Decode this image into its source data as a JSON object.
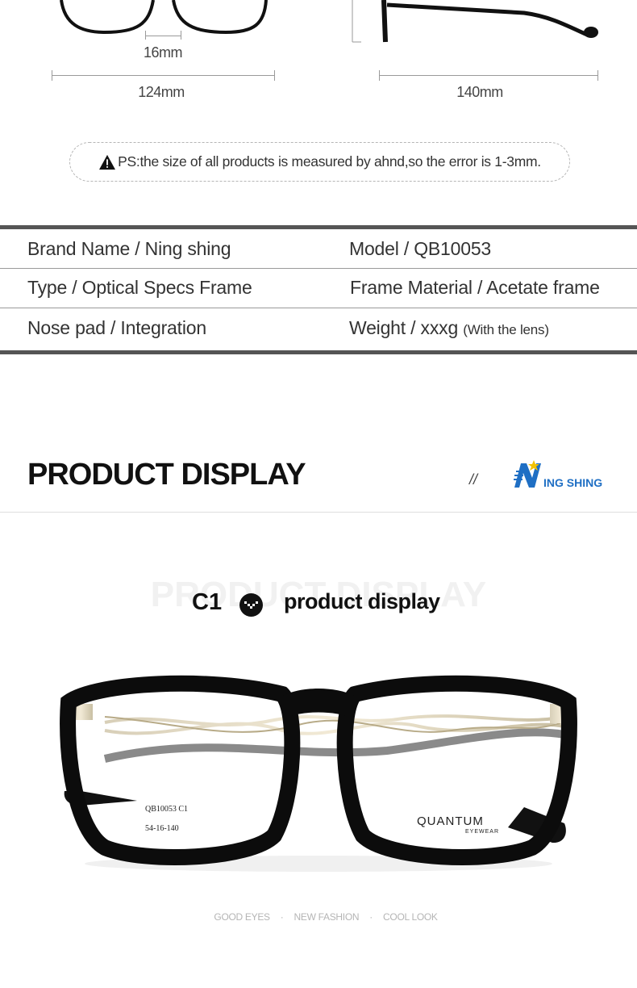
{
  "dimensions": {
    "bridge": "16mm",
    "frame_width": "124mm",
    "temple_length": "140mm"
  },
  "note": {
    "text": "PS:the size of all products is measured by ahnd,so the error is 1-3mm."
  },
  "specs": {
    "brand_label": "Brand Name  /   Ning shing",
    "model_label": "Model /  QB10053",
    "type_label": "Type  /  Optical Specs Frame",
    "material_label": "Frame Material  /  Acetate frame",
    "nosepad_label": "Nose pad  / Integration",
    "weight_label": "Weight  /   xxxg",
    "weight_note": "(With the lens)"
  },
  "section": {
    "title": "PRODUCT DISPLAY",
    "slash": "//",
    "logo_text": "ING SHING"
  },
  "color_section": {
    "ghost": "PRODUCT DISPLAY",
    "code": "C1",
    "label": "product display"
  },
  "product": {
    "lens_text_1": "QB10053  C1",
    "lens_text_2": "54-16-140",
    "brand_top": "QUANTUM",
    "brand_bottom": "EYEWEAR"
  },
  "tagline": {
    "item1": "GOOD EYES",
    "sep1": "·",
    "item2": "NEW FASHION",
    "sep2": "·",
    "item3": "COOL LOOK"
  },
  "colors": {
    "accent_blue": "#1f6fc4",
    "accent_yellow": "#f2c200",
    "table_bar": "#555555"
  }
}
